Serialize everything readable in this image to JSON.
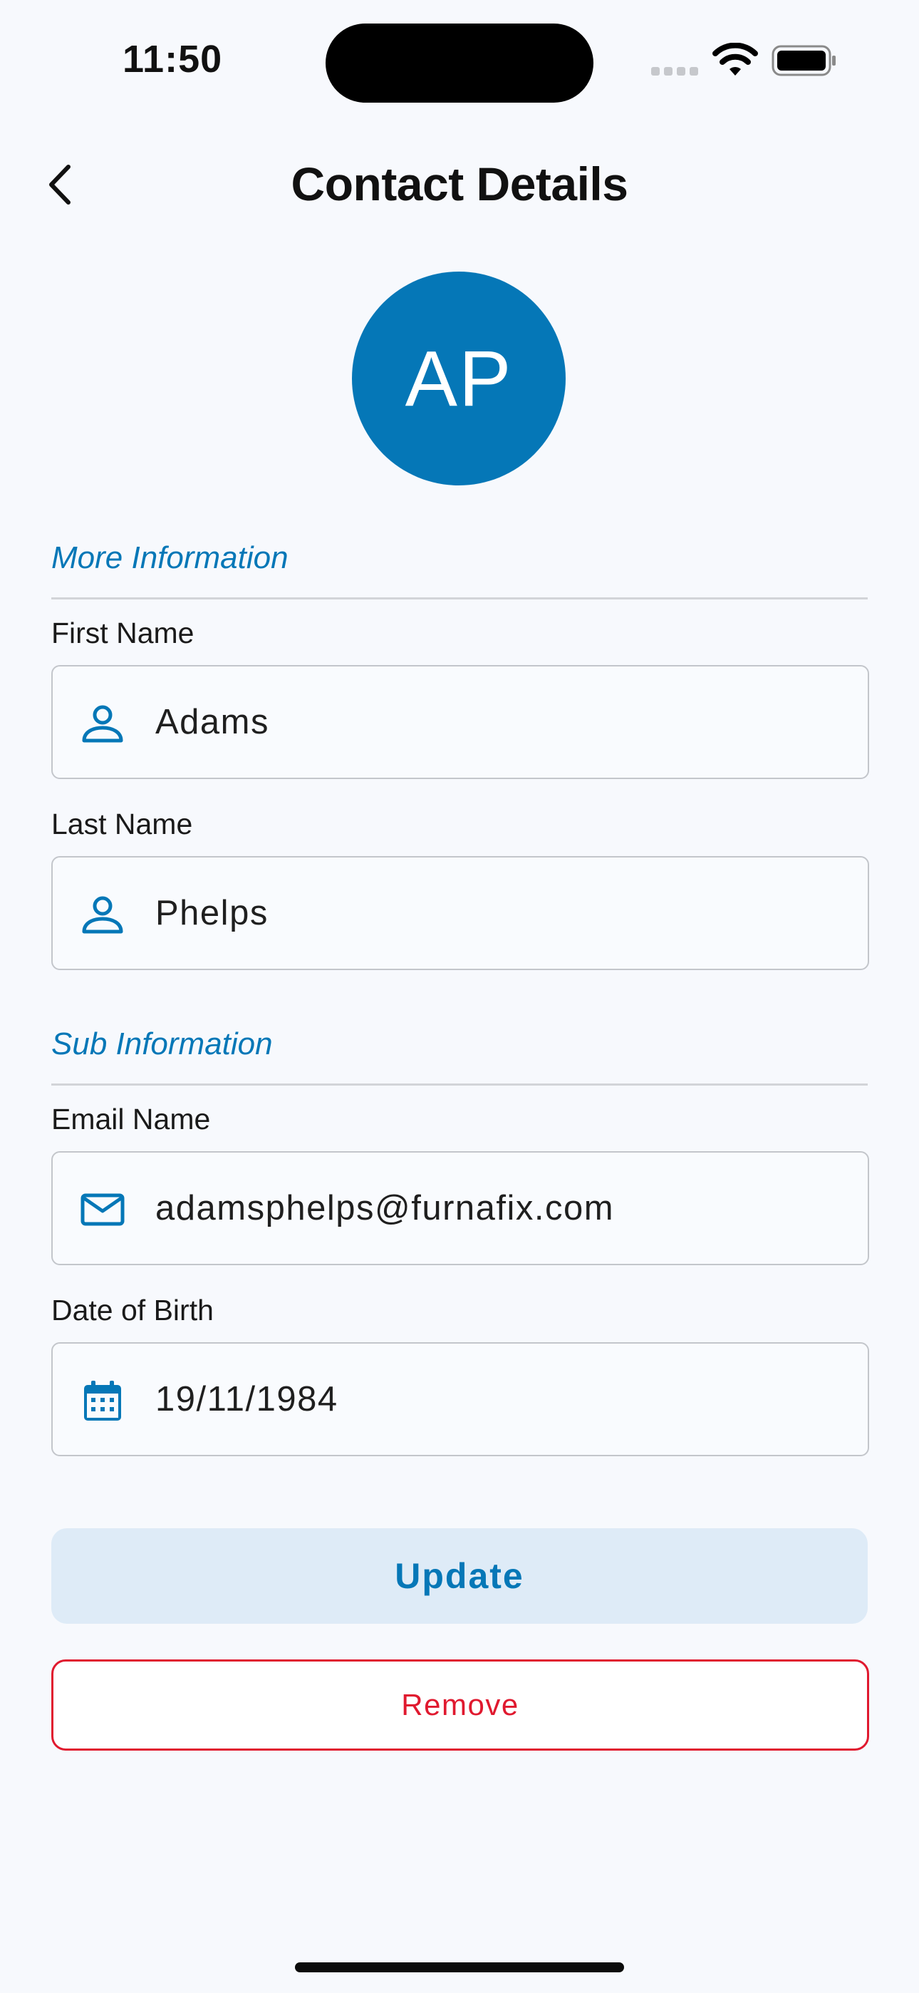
{
  "status_bar": {
    "time": "11:50"
  },
  "header": {
    "title": "Contact Details",
    "back_icon": "chevron-left-icon"
  },
  "avatar": {
    "initials": "AP",
    "color": "#0577b7"
  },
  "sections": {
    "more_information": {
      "title": "More Information",
      "first_name": {
        "label": "First Name",
        "value": "Adams",
        "icon": "person-icon"
      },
      "last_name": {
        "label": "Last Name",
        "value": "Phelps",
        "icon": "person-icon"
      }
    },
    "sub_information": {
      "title": "Sub Information",
      "email": {
        "label": "Email Name",
        "value": "adamsphelps@furnafix.com",
        "icon": "envelope-icon"
      },
      "dob": {
        "label": "Date of Birth",
        "value": "19/11/1984",
        "icon": "calendar-icon"
      }
    }
  },
  "actions": {
    "update_label": "Update",
    "remove_label": "Remove"
  },
  "colors": {
    "accent": "#0577b7",
    "danger": "#e0192f",
    "update_bg": "#deebf7",
    "background": "#f7f9fd"
  }
}
